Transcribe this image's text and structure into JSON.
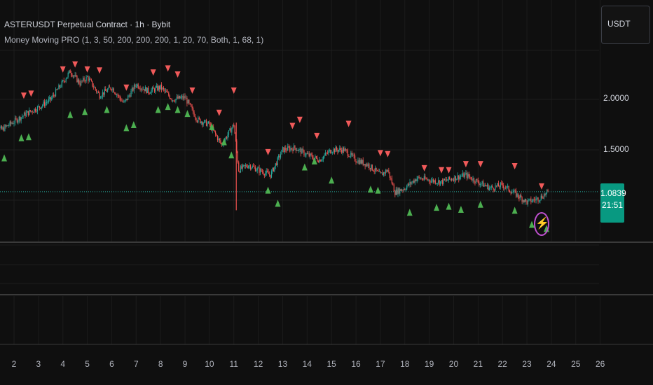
{
  "header": {
    "title": "ASTERUSDT Perpetual Contract · 1h · Bybit",
    "indicator": "Money Moving PRO (1, 3, 50, 200, 200, 200, 1, 20, 70, Both, 1, 68, 1)"
  },
  "currency": {
    "label": "USDT"
  },
  "price_badge": {
    "price": "1.0839",
    "countdown": "21:51"
  },
  "signal_icon": "lightning-icon",
  "colors": {
    "up": "#26a69a",
    "down": "#ef5350",
    "buy_marker": "#4caf50",
    "sell_marker": "#f05a5a",
    "badge": "#089981",
    "background": "#0f0f0f"
  },
  "chart_data": {
    "type": "candlestick",
    "title": "",
    "y_ticks": [
      "2.0000",
      "1.5000"
    ],
    "x_ticks": [
      "2",
      "3",
      "4",
      "5",
      "6",
      "7",
      "8",
      "9",
      "10",
      "11",
      "12",
      "13",
      "14",
      "15",
      "16",
      "17",
      "18",
      "19",
      "20",
      "21",
      "22",
      "23",
      "24",
      "25",
      "26"
    ],
    "ylim": [
      0.6,
      2.5
    ],
    "last_price": 1.0839,
    "close_series": [
      {
        "x": 1.0,
        "y": 1.75
      },
      {
        "x": 1.5,
        "y": 1.7
      },
      {
        "x": 2.0,
        "y": 1.78
      },
      {
        "x": 2.5,
        "y": 1.86
      },
      {
        "x": 3.0,
        "y": 1.92
      },
      {
        "x": 3.5,
        "y": 2.0
      },
      {
        "x": 4.0,
        "y": 2.17
      },
      {
        "x": 4.3,
        "y": 2.28
      },
      {
        "x": 4.7,
        "y": 2.16
      },
      {
        "x": 5.0,
        "y": 2.22
      },
      {
        "x": 5.5,
        "y": 2.04
      },
      {
        "x": 6.0,
        "y": 2.12
      },
      {
        "x": 6.5,
        "y": 1.96
      },
      {
        "x": 7.0,
        "y": 2.15
      },
      {
        "x": 7.5,
        "y": 2.08
      },
      {
        "x": 8.0,
        "y": 2.12
      },
      {
        "x": 8.5,
        "y": 2.0
      },
      {
        "x": 9.0,
        "y": 2.02
      },
      {
        "x": 9.5,
        "y": 1.8
      },
      {
        "x": 10.0,
        "y": 1.75
      },
      {
        "x": 10.5,
        "y": 1.55
      },
      {
        "x": 11.0,
        "y": 1.75
      },
      {
        "x": 11.2,
        "y": 1.3
      },
      {
        "x": 11.6,
        "y": 1.35
      },
      {
        "x": 12.0,
        "y": 1.3
      },
      {
        "x": 12.5,
        "y": 1.25
      },
      {
        "x": 13.0,
        "y": 1.5
      },
      {
        "x": 13.5,
        "y": 1.52
      },
      {
        "x": 14.0,
        "y": 1.45
      },
      {
        "x": 14.5,
        "y": 1.4
      },
      {
        "x": 15.0,
        "y": 1.5
      },
      {
        "x": 15.5,
        "y": 1.5
      },
      {
        "x": 16.0,
        "y": 1.4
      },
      {
        "x": 16.5,
        "y": 1.35
      },
      {
        "x": 17.0,
        "y": 1.25
      },
      {
        "x": 17.3,
        "y": 1.3
      },
      {
        "x": 17.6,
        "y": 1.08
      },
      {
        "x": 18.0,
        "y": 1.12
      },
      {
        "x": 18.5,
        "y": 1.22
      },
      {
        "x": 19.0,
        "y": 1.2
      },
      {
        "x": 19.5,
        "y": 1.18
      },
      {
        "x": 20.0,
        "y": 1.22
      },
      {
        "x": 20.5,
        "y": 1.25
      },
      {
        "x": 21.0,
        "y": 1.18
      },
      {
        "x": 21.5,
        "y": 1.12
      },
      {
        "x": 22.0,
        "y": 1.15
      },
      {
        "x": 22.3,
        "y": 1.1
      },
      {
        "x": 22.6,
        "y": 1.05
      },
      {
        "x": 23.0,
        "y": 0.98
      },
      {
        "x": 23.5,
        "y": 1.02
      },
      {
        "x": 23.9,
        "y": 1.084
      }
    ],
    "sell_signals": [
      {
        "x": 1.2,
        "y": 1.95
      },
      {
        "x": 2.4,
        "y": 2.04
      },
      {
        "x": 2.7,
        "y": 2.06
      },
      {
        "x": 4.0,
        "y": 2.3
      },
      {
        "x": 4.5,
        "y": 2.35
      },
      {
        "x": 5.0,
        "y": 2.3
      },
      {
        "x": 5.5,
        "y": 2.29
      },
      {
        "x": 6.6,
        "y": 2.12
      },
      {
        "x": 7.7,
        "y": 2.27
      },
      {
        "x": 8.3,
        "y": 2.31
      },
      {
        "x": 8.7,
        "y": 2.25
      },
      {
        "x": 9.3,
        "y": 2.09
      },
      {
        "x": 10.4,
        "y": 1.87
      },
      {
        "x": 11.0,
        "y": 2.09
      },
      {
        "x": 12.4,
        "y": 1.48
      },
      {
        "x": 13.4,
        "y": 1.74
      },
      {
        "x": 13.7,
        "y": 1.8
      },
      {
        "x": 14.4,
        "y": 1.64
      },
      {
        "x": 15.7,
        "y": 1.76
      },
      {
        "x": 17.0,
        "y": 1.47
      },
      {
        "x": 17.3,
        "y": 1.46
      },
      {
        "x": 18.8,
        "y": 1.32
      },
      {
        "x": 19.5,
        "y": 1.3
      },
      {
        "x": 19.8,
        "y": 1.3
      },
      {
        "x": 20.5,
        "y": 1.36
      },
      {
        "x": 21.1,
        "y": 1.36
      },
      {
        "x": 22.5,
        "y": 1.34
      },
      {
        "x": 23.6,
        "y": 1.14
      }
    ],
    "buy_signals": [
      {
        "x": 1.0,
        "y": 1.38
      },
      {
        "x": 1.6,
        "y": 1.42
      },
      {
        "x": 2.3,
        "y": 1.62
      },
      {
        "x": 2.6,
        "y": 1.63
      },
      {
        "x": 4.3,
        "y": 1.85
      },
      {
        "x": 4.9,
        "y": 1.88
      },
      {
        "x": 5.8,
        "y": 1.9
      },
      {
        "x": 6.6,
        "y": 1.72
      },
      {
        "x": 6.9,
        "y": 1.75
      },
      {
        "x": 7.9,
        "y": 1.9
      },
      {
        "x": 8.3,
        "y": 1.93
      },
      {
        "x": 8.7,
        "y": 1.9
      },
      {
        "x": 9.1,
        "y": 1.86
      },
      {
        "x": 10.1,
        "y": 1.73
      },
      {
        "x": 10.6,
        "y": 1.58
      },
      {
        "x": 10.9,
        "y": 1.45
      },
      {
        "x": 12.4,
        "y": 1.1
      },
      {
        "x": 12.8,
        "y": 0.97
      },
      {
        "x": 13.9,
        "y": 1.33
      },
      {
        "x": 14.3,
        "y": 1.39
      },
      {
        "x": 15.0,
        "y": 1.2
      },
      {
        "x": 16.6,
        "y": 1.11
      },
      {
        "x": 16.9,
        "y": 1.1
      },
      {
        "x": 18.2,
        "y": 0.88
      },
      {
        "x": 19.3,
        "y": 0.93
      },
      {
        "x": 19.8,
        "y": 0.94
      },
      {
        "x": 20.3,
        "y": 0.91
      },
      {
        "x": 21.1,
        "y": 0.96
      },
      {
        "x": 22.5,
        "y": 0.9
      },
      {
        "x": 23.2,
        "y": 0.76
      },
      {
        "x": 23.8,
        "y": 0.72
      }
    ]
  }
}
